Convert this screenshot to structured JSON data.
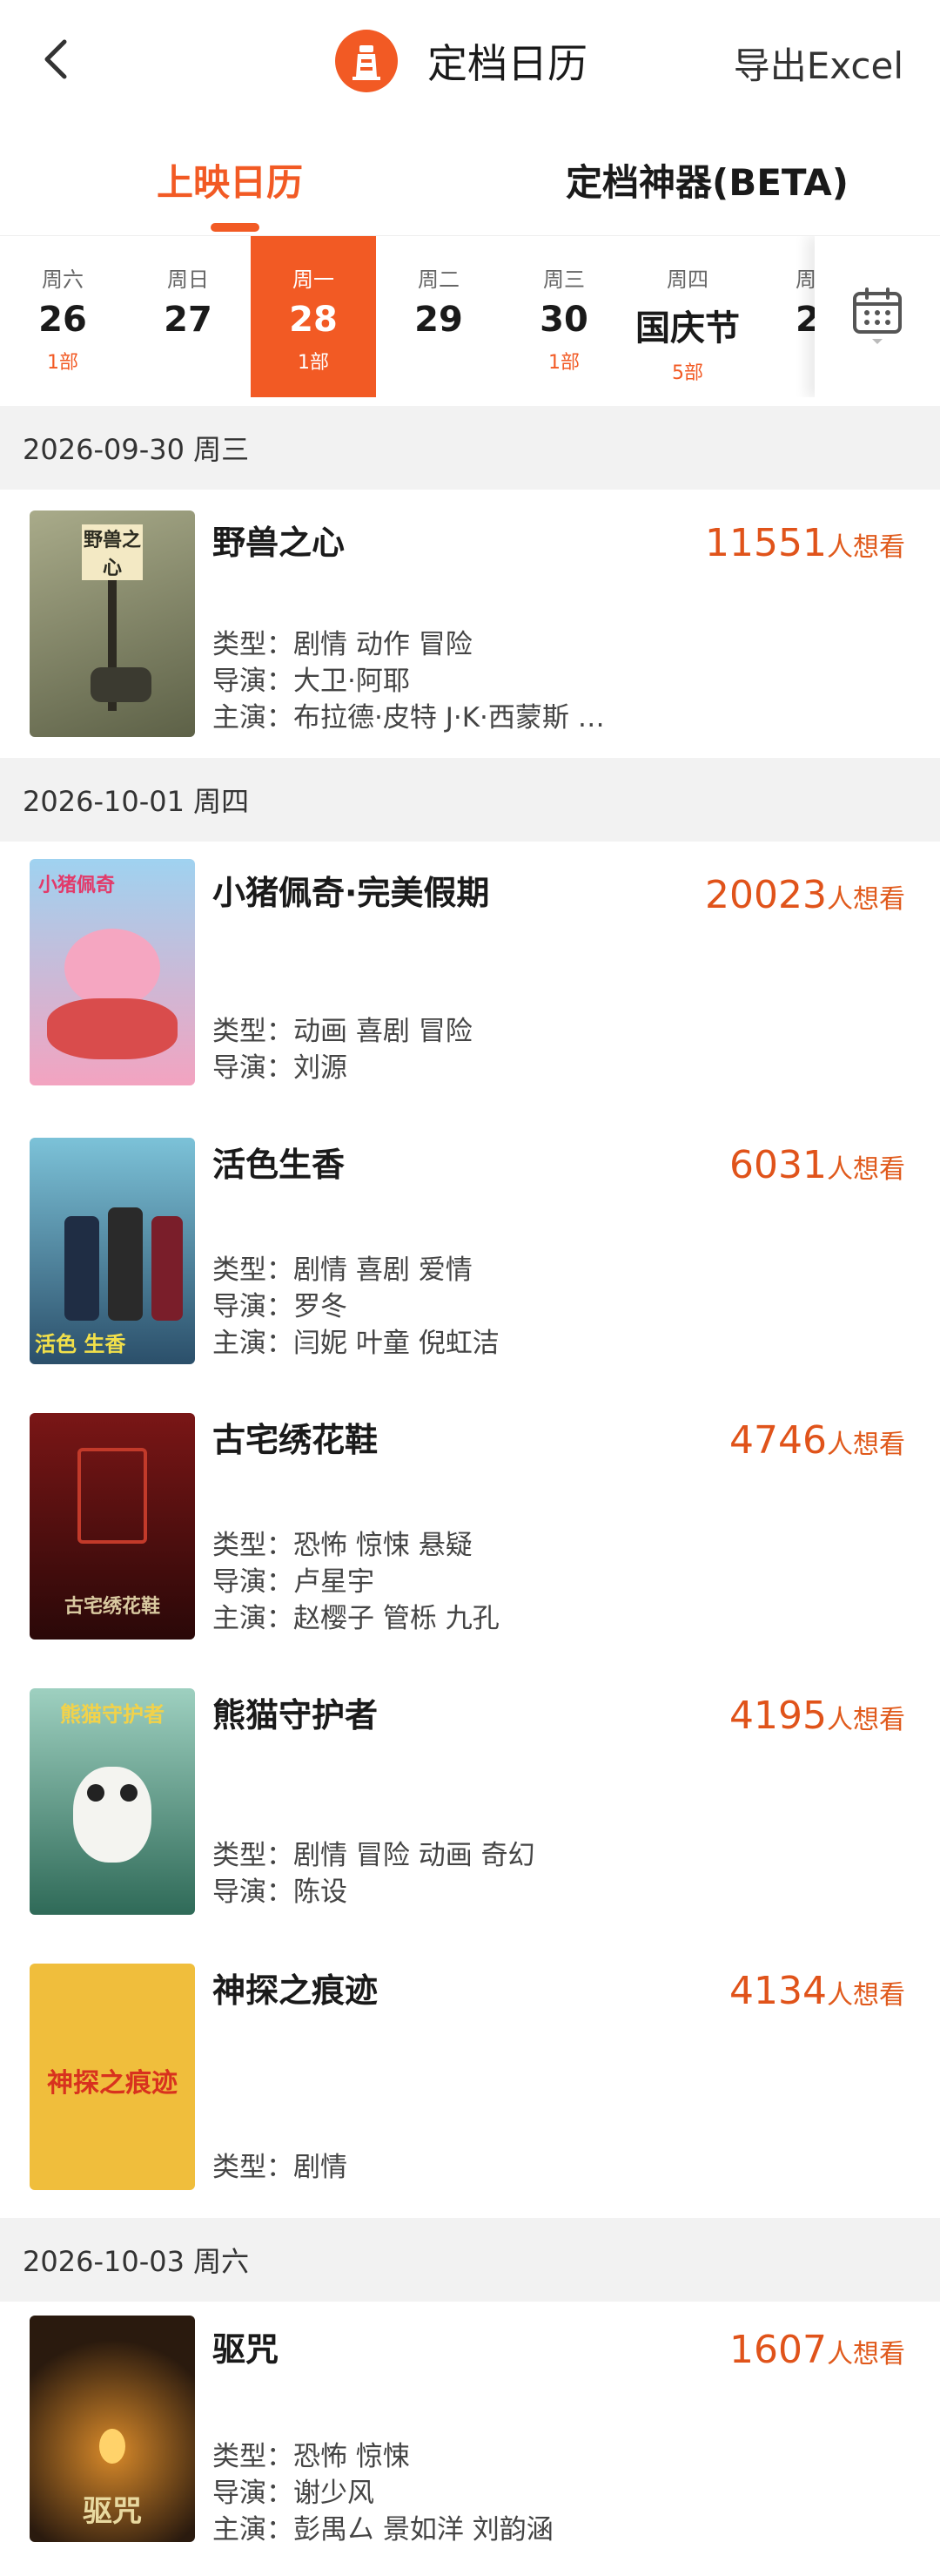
{
  "header": {
    "title": "定档日历",
    "export_label": "导出Excel"
  },
  "tabs": [
    {
      "label": "上映日历"
    },
    {
      "label": "定档神器(BETA)"
    }
  ],
  "dates": [
    {
      "weekday": "周六",
      "day": "26",
      "count": "1部"
    },
    {
      "weekday": "周日",
      "day": "27",
      "count": ""
    },
    {
      "weekday": "周一",
      "day": "28",
      "count": "1部"
    },
    {
      "weekday": "周二",
      "day": "29",
      "count": ""
    },
    {
      "weekday": "周三",
      "day": "30",
      "count": "1部"
    },
    {
      "weekday": "周四",
      "day": "国庆节",
      "count": "5部"
    },
    {
      "weekday": "周",
      "day": "2",
      "count": ""
    }
  ],
  "labels": {
    "want": "人想看",
    "type": "类型：",
    "director": "导演：",
    "cast": "主演："
  },
  "sections": [
    {
      "date": "2026-09-30 周三"
    },
    {
      "date": "2026-10-01 周四"
    },
    {
      "date": "2026-10-03 周六"
    }
  ],
  "movies": [
    {
      "title": "野兽之心",
      "want": "11551",
      "genre": "剧情 动作 冒险",
      "director": "大卫·阿耶",
      "cast": "布拉德·皮特 J·K·西蒙斯 …",
      "poster_text": "野兽之心",
      "poster_color": "#8a8f6a"
    },
    {
      "title": "小猪佩奇·完美假期",
      "want": "20023",
      "genre": "动画 喜剧 冒险",
      "director": "刘源",
      "cast": "",
      "poster_text": "小猪佩奇",
      "poster_color": "#e8839a"
    },
    {
      "title": "活色生香",
      "want": "6031",
      "genre": "剧情 喜剧 爱情",
      "director": "罗冬",
      "cast": "闫妮 叶童 倪虹洁",
      "poster_text": "活色 生香",
      "poster_color": "#3a6e8c"
    },
    {
      "title": "古宅绣花鞋",
      "want": "4746",
      "genre": "恐怖 惊悚 悬疑",
      "director": "卢星宇",
      "cast": "赵樱子 管栎 九孔",
      "poster_text": "古宅绣花鞋",
      "poster_color": "#5a1616"
    },
    {
      "title": "熊猫守护者",
      "want": "4195",
      "genre": "剧情 冒险 动画 奇幻",
      "director": "陈设",
      "cast": "",
      "poster_text": "熊猫守护者",
      "poster_color": "#6fa88e"
    },
    {
      "title": "神探之痕迹",
      "want": "4134",
      "genre": "剧情",
      "director": "",
      "cast": "",
      "poster_text": "神探之痕迹",
      "poster_color": "#f0be3c"
    },
    {
      "title": "驱咒",
      "want": "1607",
      "genre": "恐怖 惊悚",
      "director": "谢少风",
      "cast": "彭禺厶 景如洋 刘韵涵",
      "poster_text": "驱咒",
      "poster_color": "#3a2a18"
    }
  ]
}
